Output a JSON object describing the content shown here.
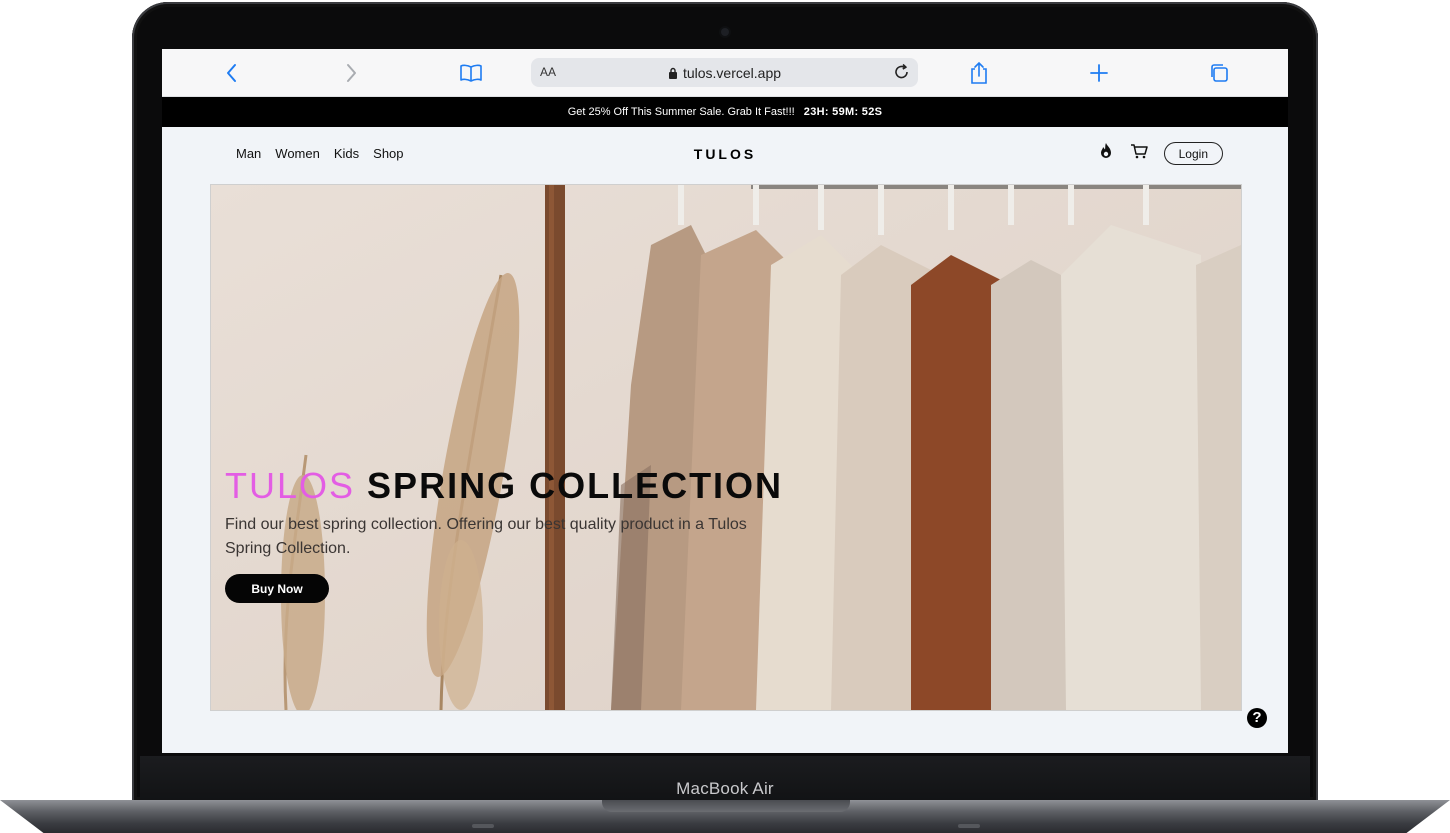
{
  "device": {
    "label": "MacBook Air"
  },
  "browser": {
    "aa_label": "AA",
    "url": "tulos.vercel.app",
    "icons": [
      "back-icon",
      "forward-icon",
      "bookmarks-icon",
      "lock-icon",
      "reload-icon",
      "share-icon",
      "new-tab-icon",
      "tabs-icon"
    ]
  },
  "promo": {
    "text": "Get 25% Off This Summer Sale. Grab It Fast!!!",
    "timer": "23H: 59M: 52S"
  },
  "nav": {
    "links": [
      "Man",
      "Women",
      "Kids",
      "Shop"
    ],
    "brand": "TULOS",
    "login_label": "Login",
    "icons": [
      "fire-icon",
      "cart-icon"
    ]
  },
  "hero": {
    "title_accent": "TULOS",
    "title_rest": "SPRING COLLECTION",
    "subtitle": "Find our best spring collection. Offering our best quality product in a Tulos Spring Collection.",
    "button_label": "Buy Now"
  },
  "help": {
    "icon": "help-icon",
    "glyph": "?"
  },
  "colors": {
    "accent": "#e35de4",
    "promo_bg": "#000000",
    "page_bg": "#f1f4f8"
  }
}
